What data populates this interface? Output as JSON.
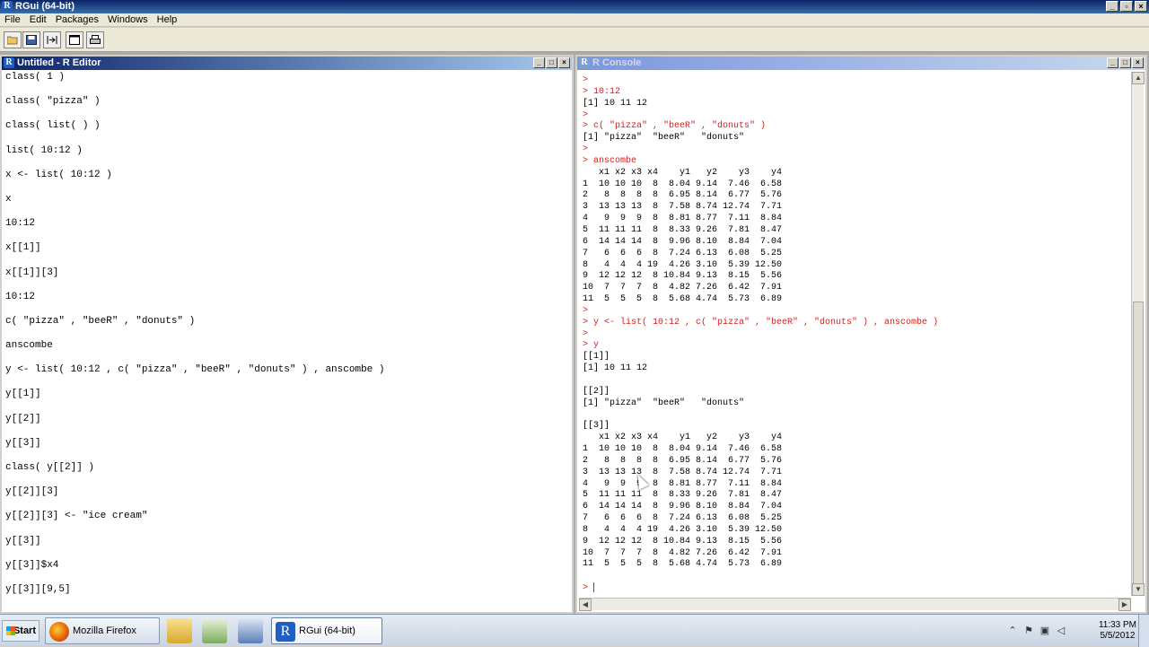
{
  "app": {
    "title": "RGui (64-bit)",
    "menus": [
      "File",
      "Edit",
      "Packages",
      "Windows",
      "Help"
    ],
    "toolbar_icons": [
      "open-script-icon",
      "save-icon",
      "run-line-icon",
      "clear-console-icon",
      "print-icon"
    ]
  },
  "editor": {
    "title": "Untitled - R Editor",
    "lines": [
      "class( 1 )",
      "class( \"pizza\" )",
      "class( list( ) )",
      "list( 10:12 )",
      "x <- list( 10:12 )",
      "x",
      "10:12",
      "x[[1]]",
      "x[[1]][3]",
      "10:12",
      "c( \"pizza\" , \"beeR\" , \"donuts\" )",
      "anscombe",
      "y <- list( 10:12 , c( \"pizza\" , \"beeR\" , \"donuts\" ) , anscombe )",
      "y[[1]]",
      "y[[2]]",
      "y[[3]]",
      "class( y[[2]] )",
      "y[[2]][3]",
      "y[[2]][3] <- \"ice cream\"",
      "y[[3]]",
      "y[[3]]$x4",
      "y[[3]][9,5]"
    ]
  },
  "console": {
    "title": "R Console",
    "lines": [
      {
        "t": ">",
        "red": true
      },
      {
        "t": "> 10:12",
        "red": true
      },
      {
        "t": "[1] 10 11 12",
        "red": false
      },
      {
        "t": ">",
        "red": true
      },
      {
        "t": "> c( \"pizza\" , \"beeR\" , \"donuts\" )",
        "red": true
      },
      {
        "t": "[1] \"pizza\"  \"beeR\"   \"donuts\"",
        "red": false
      },
      {
        "t": ">",
        "red": true
      },
      {
        "t": "> anscombe",
        "red": true
      },
      {
        "t": "   x1 x2 x3 x4    y1   y2    y3    y4",
        "red": false
      },
      {
        "t": "1  10 10 10  8  8.04 9.14  7.46  6.58",
        "red": false
      },
      {
        "t": "2   8  8  8  8  6.95 8.14  6.77  5.76",
        "red": false
      },
      {
        "t": "3  13 13 13  8  7.58 8.74 12.74  7.71",
        "red": false
      },
      {
        "t": "4   9  9  9  8  8.81 8.77  7.11  8.84",
        "red": false
      },
      {
        "t": "5  11 11 11  8  8.33 9.26  7.81  8.47",
        "red": false
      },
      {
        "t": "6  14 14 14  8  9.96 8.10  8.84  7.04",
        "red": false
      },
      {
        "t": "7   6  6  6  8  7.24 6.13  6.08  5.25",
        "red": false
      },
      {
        "t": "8   4  4  4 19  4.26 3.10  5.39 12.50",
        "red": false
      },
      {
        "t": "9  12 12 12  8 10.84 9.13  8.15  5.56",
        "red": false
      },
      {
        "t": "10  7  7  7  8  4.82 7.26  6.42  7.91",
        "red": false
      },
      {
        "t": "11  5  5  5  8  5.68 4.74  5.73  6.89",
        "red": false
      },
      {
        "t": ">",
        "red": true
      },
      {
        "t": "> y <- list( 10:12 , c( \"pizza\" , \"beeR\" , \"donuts\" ) , anscombe )",
        "red": true
      },
      {
        "t": ">",
        "red": true
      },
      {
        "t": "> y",
        "red": true
      },
      {
        "t": "[[1]]",
        "red": false
      },
      {
        "t": "[1] 10 11 12",
        "red": false
      },
      {
        "t": "",
        "red": false
      },
      {
        "t": "[[2]]",
        "red": false
      },
      {
        "t": "[1] \"pizza\"  \"beeR\"   \"donuts\"",
        "red": false
      },
      {
        "t": "",
        "red": false
      },
      {
        "t": "[[3]]",
        "red": false
      },
      {
        "t": "   x1 x2 x3 x4    y1   y2    y3    y4",
        "red": false
      },
      {
        "t": "1  10 10 10  8  8.04 9.14  7.46  6.58",
        "red": false
      },
      {
        "t": "2   8  8  8  8  6.95 8.14  6.77  5.76",
        "red": false
      },
      {
        "t": "3  13 13 13  8  7.58 8.74 12.74  7.71",
        "red": false
      },
      {
        "t": "4   9  9  9  8  8.81 8.77  7.11  8.84",
        "red": false
      },
      {
        "t": "5  11 11 11  8  8.33 9.26  7.81  8.47",
        "red": false
      },
      {
        "t": "6  14 14 14  8  9.96 8.10  8.84  7.04",
        "red": false
      },
      {
        "t": "7   6  6  6  8  7.24 6.13  6.08  5.25",
        "red": false
      },
      {
        "t": "8   4  4  4 19  4.26 3.10  5.39 12.50",
        "red": false
      },
      {
        "t": "9  12 12 12  8 10.84 9.13  8.15  5.56",
        "red": false
      },
      {
        "t": "10  7  7  7  8  4.82 7.26  6.42  7.91",
        "red": false
      },
      {
        "t": "11  5  5  5  8  5.68 4.74  5.73  6.89",
        "red": false
      },
      {
        "t": "",
        "red": false
      },
      {
        "t": "> ",
        "red": true,
        "cursor": true
      }
    ]
  },
  "taskbar": {
    "start_label": "Start",
    "tasks": [
      {
        "label": "Mozilla Firefox",
        "icon": "firefox-icon"
      },
      {
        "label": "RGui (64-bit)",
        "icon": "r-icon"
      }
    ],
    "clock_time": "11:33 PM",
    "clock_date": "5/5/2012"
  },
  "colors": {
    "console_input": "#d42020",
    "active_title": "#0a246a"
  }
}
